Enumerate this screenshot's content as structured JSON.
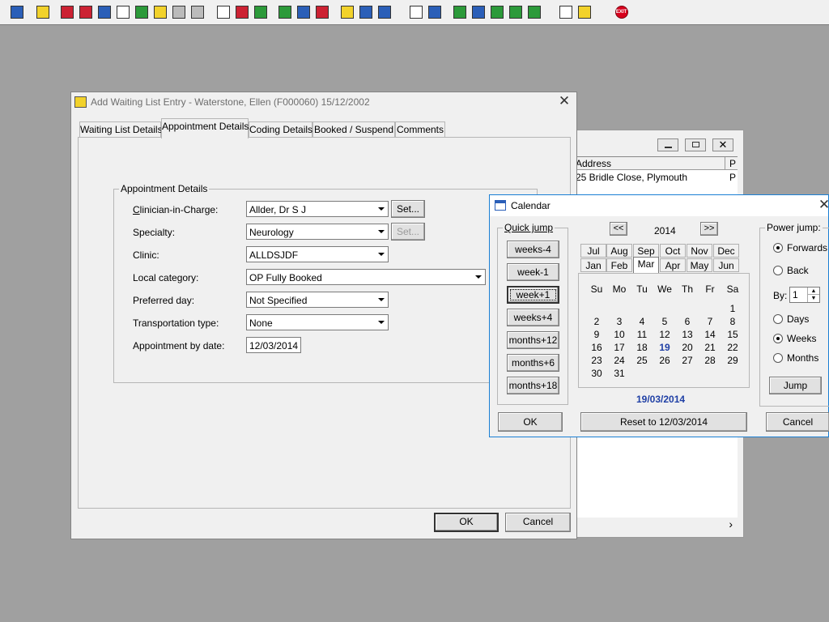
{
  "toolbar": {
    "icons": [
      "patient-icon",
      "print-icon",
      "book-icon",
      "edit-icon",
      "list-icon",
      "mail-icon",
      "person-icon",
      "notes-icon",
      "ward-icon",
      "camera-icon",
      "search-icon",
      "clock-icon",
      "screen-icon",
      "image-icon",
      "form-icon",
      "gauge-icon",
      "note-icon",
      "bed-icon",
      "transfer-icon",
      "document-icon",
      "chart-icon",
      "globe-icon",
      "check-icon",
      "flag-icon",
      "download-icon",
      "refresh-icon",
      "swap-icon",
      "warning-icon",
      "exit-icon"
    ],
    "exit_label": "EXIT"
  },
  "main_dialog": {
    "title": "Add Waiting List Entry - Waterstone, Ellen (F000060) 15/12/2002",
    "tabs": [
      "Waiting List Details",
      "Appointment Details",
      "Coding Details",
      "Booked / Suspend",
      "Comments"
    ],
    "active_tab": "Appointment Details",
    "group_label": "Appointment Details",
    "fields": {
      "clinician": {
        "label": "Clinician-in-Charge:",
        "value": "Allder, Dr S J"
      },
      "specialty": {
        "label": "Specialty:",
        "value": "Neurology"
      },
      "clinic": {
        "label": "Clinic:",
        "value": "ALLDSJDF"
      },
      "local_category": {
        "label": "Local category:",
        "value": "OP Fully Booked"
      },
      "preferred_day": {
        "label": "Preferred day:",
        "value": "Not Specified"
      },
      "transportation": {
        "label": "Transportation type:",
        "value": "None"
      },
      "appointment_by_date": {
        "label": "Appointment by date:",
        "value": "12/03/2014"
      }
    },
    "set_button": "Set...",
    "set_button_2": "Set...",
    "ok": "OK",
    "cancel": "Cancel"
  },
  "background_window": {
    "col_address": "Address",
    "col_p": "P",
    "row_address": "25 Bridle Close, Plymouth",
    "row_p": "P",
    "scroll_right": "›"
  },
  "calendar": {
    "title": "Calendar",
    "quick_jump_label": "Quick jump",
    "quick_jump": [
      "weeks-4",
      "week-1",
      "week+1",
      "weeks+4",
      "months+12",
      "months+6",
      "months+18"
    ],
    "prev": "<<",
    "next": ">>",
    "year": "2014",
    "months_row1": [
      "Jul",
      "Aug",
      "Sep",
      "Oct",
      "Nov",
      "Dec"
    ],
    "months_row2": [
      "Jan",
      "Feb",
      "Mar",
      "Apr",
      "May",
      "Jun"
    ],
    "selected_month": "Mar",
    "weekdays": [
      "Su",
      "Mo",
      "Tu",
      "We",
      "Th",
      "Fr",
      "Sa"
    ],
    "days": [
      [
        "",
        "",
        "",
        "",
        "",
        "",
        "1"
      ],
      [
        "2",
        "3",
        "4",
        "5",
        "6",
        "7",
        "8"
      ],
      [
        "9",
        "10",
        "11",
        "12",
        "13",
        "14",
        "15"
      ],
      [
        "16",
        "17",
        "18",
        "19",
        "20",
        "21",
        "22"
      ],
      [
        "23",
        "24",
        "25",
        "26",
        "27",
        "28",
        "29"
      ],
      [
        "30",
        "31",
        "",
        "",
        "",
        "",
        ""
      ]
    ],
    "today": "19",
    "selected_date": "19/03/2014",
    "power_jump_label": "Power jump:",
    "forwards": "Forwards",
    "back": "Back",
    "by_label": "By:",
    "by_value": "1",
    "days_label": "Days",
    "weeks_label": "Weeks",
    "months_label": "Months",
    "jump": "Jump",
    "ok": "OK",
    "reset": "Reset to 12/03/2014",
    "cancel": "Cancel"
  }
}
